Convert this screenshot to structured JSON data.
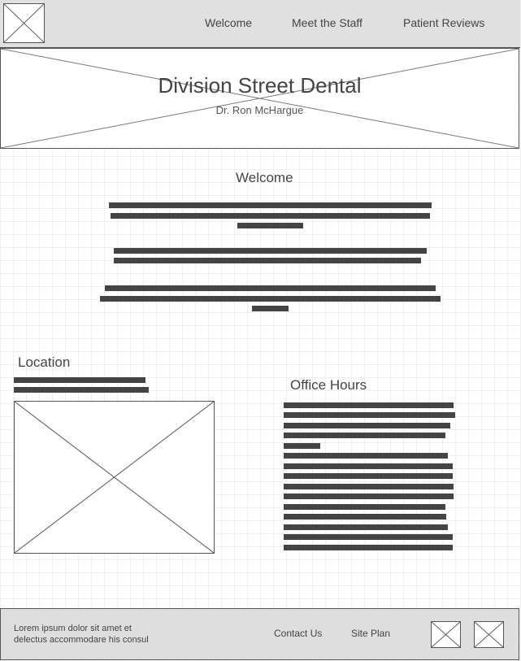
{
  "nav": {
    "logo_icon": "image-placeholder-icon",
    "links": [
      "Welcome",
      "Meet the Staff",
      "Patient Reviews"
    ]
  },
  "hero": {
    "title": "Division Street Dental",
    "subtitle": "Dr. Ron McHargue"
  },
  "welcome": {
    "heading": "Welcome"
  },
  "location": {
    "heading": "Location",
    "map_icon": "image-placeholder-icon"
  },
  "office_hours": {
    "heading": "Office Hours"
  },
  "footer": {
    "text_line1": "Lorem ipsum dolor sit amet et",
    "text_line2": "delectus accommodare his consul",
    "links": [
      "Contact Us",
      "Site Plan"
    ],
    "icons": [
      "image-placeholder-icon",
      "image-placeholder-icon"
    ]
  },
  "colors": {
    "header_bg": "#e0e0e0",
    "footer_bg": "#dedede",
    "text_bar": "#444444",
    "border": "#555555"
  }
}
